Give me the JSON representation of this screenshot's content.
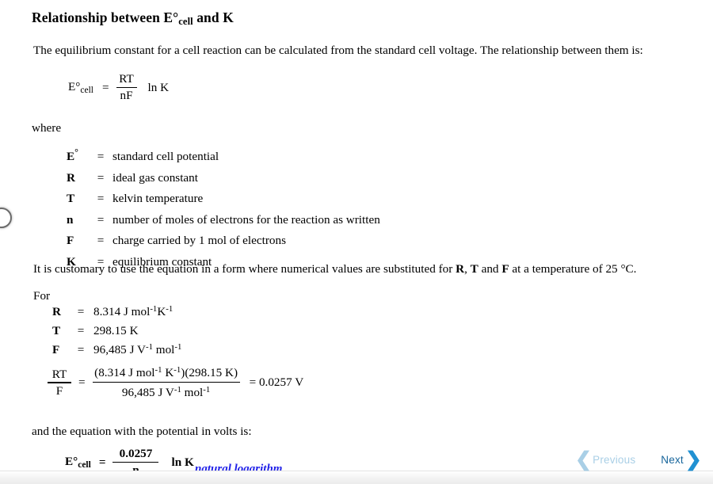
{
  "page": {
    "title_prefix": "Relationship between E°",
    "title_sub": "cell",
    "title_suffix": " and K",
    "intro": "The equilibrium constant for a cell reaction can be calculated from the standard cell voltage. The relationship between them is:",
    "where_label": "where",
    "customary": "It is customary to use the equation in a form where numerical values are substituted for ",
    "customary_sym1": "R",
    "customary_mid1": ", ",
    "customary_sym2": "T",
    "customary_mid2": " and ",
    "customary_sym3": "F",
    "customary_tail": " at a temperature of 25 °C.",
    "for_label": "For",
    "and_equation": "and the equation with the potential in volts is:"
  },
  "equation_main": {
    "lhs": "E°",
    "lhs_sub": "cell",
    "equals": "=",
    "numerator": "RT",
    "denominator": "nF",
    "rhs": "ln K"
  },
  "definitions": [
    {
      "symbol": "E",
      "symbol_sup": "°",
      "equals": "=",
      "description": "standard cell potential"
    },
    {
      "symbol": "R",
      "symbol_sup": "",
      "equals": "=",
      "description": "ideal gas constant"
    },
    {
      "symbol": "T",
      "symbol_sup": "",
      "equals": "=",
      "description": "kelvin temperature"
    },
    {
      "symbol": "n",
      "symbol_sup": "",
      "equals": "=",
      "description": "number of moles of electrons for the reaction as written"
    },
    {
      "symbol": "F",
      "symbol_sup": "",
      "equals": "=",
      "description": "charge carried by 1 mol of electrons"
    },
    {
      "symbol": "K",
      "symbol_sup": "",
      "equals": "=",
      "description": "equilibrium constant"
    }
  ],
  "constants": [
    {
      "symbol": "R",
      "equals": "=",
      "value": "8.314 J mol",
      "sup1": "-1",
      "mid": "K",
      "sup2": "-1",
      "tail": ""
    },
    {
      "symbol": "T",
      "equals": "=",
      "value": "298.15 K",
      "sup1": "",
      "mid": "",
      "sup2": "",
      "tail": ""
    },
    {
      "symbol": "F",
      "equals": "=",
      "value": "96,485 J V",
      "sup1": "-1",
      "mid": " mol",
      "sup2": "-1",
      "tail": ""
    }
  ],
  "equation_rtf": {
    "num_label": "RT",
    "den_label": "F",
    "equals": "=",
    "numerator_a": "(8.314 J mol",
    "numerator_sup1": "-1",
    "numerator_b": " K",
    "numerator_sup2": "-1",
    "numerator_c": ")(298.15 K)",
    "denominator_a": "96,485 J V",
    "denominator_sup1": "-1",
    "denominator_b": " mol",
    "denominator_sup2": "-1",
    "result": "= 0.0257 V"
  },
  "equation_final": {
    "lhs": "E°",
    "lhs_sub": "cell",
    "equals": "=",
    "numerator": "0.0257",
    "denominator": "n",
    "rhs": "ln K",
    "annotation": "natural logarithm"
  },
  "navigation": {
    "previous_label": "Previous",
    "next_label": "Next",
    "previous_chevron": "❮",
    "next_chevron": "❯"
  },
  "colors": {
    "annotation_blue": "#2021e8",
    "next_blue": "#17659b",
    "next_chevron_blue": "#2191d2",
    "previous_disabled_blue": "#a9cfe6"
  }
}
